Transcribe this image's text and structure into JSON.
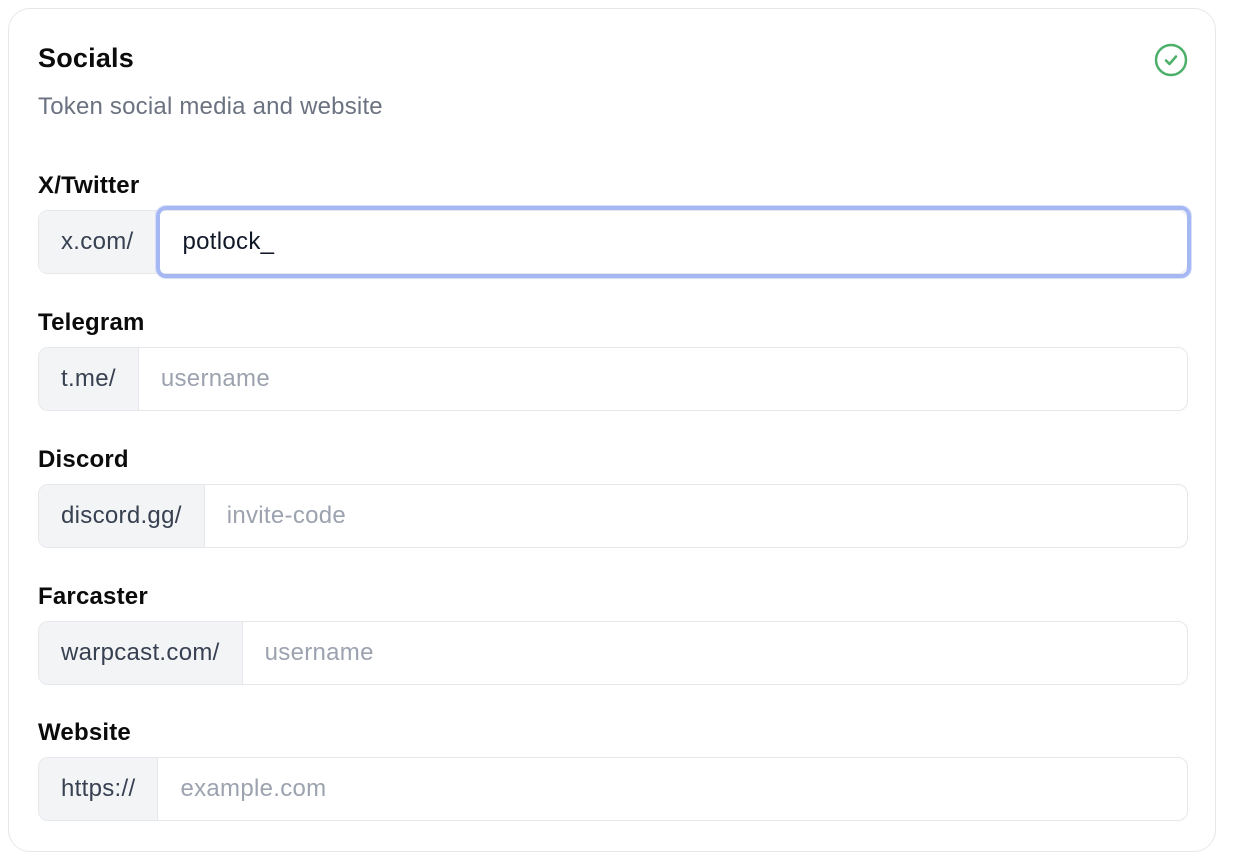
{
  "header": {
    "title": "Socials",
    "subtitle": "Token social media and website",
    "status_icon": "check-circle-icon",
    "status_color": "#4caf6a"
  },
  "fields": {
    "twitter": {
      "label": "X/Twitter",
      "prefix": "x.com/",
      "value": "potlock_",
      "placeholder": ""
    },
    "telegram": {
      "label": "Telegram",
      "prefix": "t.me/",
      "value": "",
      "placeholder": "username"
    },
    "discord": {
      "label": "Discord",
      "prefix": "discord.gg/",
      "value": "",
      "placeholder": "invite-code"
    },
    "farcaster": {
      "label": "Farcaster",
      "prefix": "warpcast.com/",
      "value": "",
      "placeholder": "username"
    },
    "website": {
      "label": "Website",
      "prefix": "https://",
      "value": "",
      "placeholder": "example.com"
    }
  },
  "colors": {
    "focus_ring": "#a5b8f3",
    "prefix_background": "#f3f4f6"
  }
}
